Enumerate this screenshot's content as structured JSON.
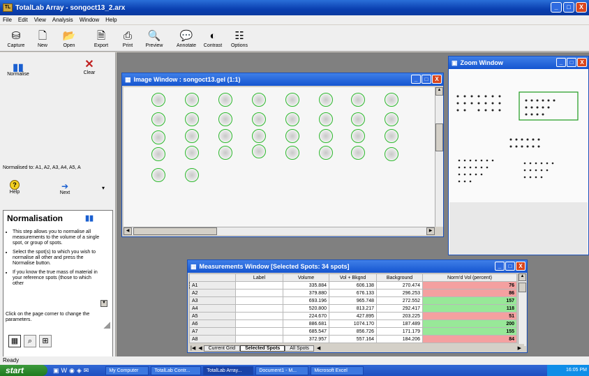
{
  "app": {
    "title": "TotalLab Array - songoct13_2.arx",
    "icon": "TL"
  },
  "window_controls": {
    "minimize": "_",
    "maximize": "□",
    "close": "X"
  },
  "menu": [
    "File",
    "Edit",
    "View",
    "Analysis",
    "Window",
    "Help"
  ],
  "toolbar": [
    {
      "label": "Capture",
      "icon": "capture-icon",
      "glyph": "⛁"
    },
    {
      "label": "New",
      "icon": "new-icon",
      "glyph": "🗋"
    },
    {
      "label": "Open",
      "icon": "open-icon",
      "glyph": "📂"
    },
    {
      "label": "Export",
      "icon": "export-icon",
      "glyph": "🗎"
    },
    {
      "label": "Print",
      "icon": "print-icon",
      "glyph": "⎙"
    },
    {
      "label": "Preview",
      "icon": "preview-icon",
      "glyph": "🔍"
    },
    {
      "label": "Annotate",
      "icon": "annotate-icon",
      "glyph": "💬"
    },
    {
      "label": "Contrast",
      "icon": "contrast-icon",
      "glyph": "◐"
    },
    {
      "label": "Options",
      "icon": "options-icon",
      "glyph": "☷"
    }
  ],
  "left": {
    "normalise_label": "Normalise",
    "clear_label": "Clear",
    "normalised_to": "Normalised to:  A1, A2, A3, A4, A5, A",
    "help_label": "Help",
    "next_label": "Next",
    "help_title": "Normalisation",
    "help_items": [
      "This step allows you to normalise all measurements to the volume of a single spot, or group of spots.",
      "Select the spot(s) to which you wish to normalise all other and press the Normalise button.",
      "If you know the true mass of material in your reference spots (those to which other"
    ],
    "help_footer": "Click on the page corner to change the parameters."
  },
  "image_window": {
    "title": "Image Window : songoct13.gel (1:1)"
  },
  "zoom_window": {
    "title": "Zoom Window"
  },
  "measurements": {
    "title": "Measurements Window [Selected Spots: 34 spots]",
    "columns": [
      "",
      "Label",
      "Volume",
      "Vol + Bkgnd",
      "Background",
      "Norm'd Vol (percent)"
    ],
    "rows": [
      {
        "id": "A1",
        "label": "",
        "volume": "335.884",
        "vb": "606.138",
        "bg": "270.474",
        "norm": "76",
        "status": "red"
      },
      {
        "id": "A2",
        "label": "",
        "volume": "379.880",
        "vb": "676.133",
        "bg": "296.253",
        "norm": "86",
        "status": "red"
      },
      {
        "id": "A3",
        "label": "",
        "volume": "693.196",
        "vb": "965.748",
        "bg": "272.552",
        "norm": "157",
        "status": "green"
      },
      {
        "id": "A4",
        "label": "",
        "volume": "520.800",
        "vb": "813.217",
        "bg": "292.417",
        "norm": "118",
        "status": "green"
      },
      {
        "id": "A5",
        "label": "",
        "volume": "224.670",
        "vb": "427.895",
        "bg": "203.225",
        "norm": "51",
        "status": "red"
      },
      {
        "id": "A6",
        "label": "",
        "volume": "886.681",
        "vb": "1074.170",
        "bg": "187.489",
        "norm": "200",
        "status": "green"
      },
      {
        "id": "A7",
        "label": "",
        "volume": "685.547",
        "vb": "856.726",
        "bg": "171.179",
        "norm": "155",
        "status": "green"
      },
      {
        "id": "A8",
        "label": "",
        "volume": "372.957",
        "vb": "557.164",
        "bg": "184.206",
        "norm": "84",
        "status": "red"
      }
    ],
    "tabs": [
      "Current Grid",
      "Selected Spots",
      "All Spots"
    ]
  },
  "status": "Ready",
  "taskbar": {
    "start": "start",
    "tasks": [
      "My Computer",
      "TotalLab Contr...",
      "TotalLab Array...",
      "Document1 - M...",
      "Microsoft Excel"
    ],
    "clock": "16:05 PM"
  }
}
